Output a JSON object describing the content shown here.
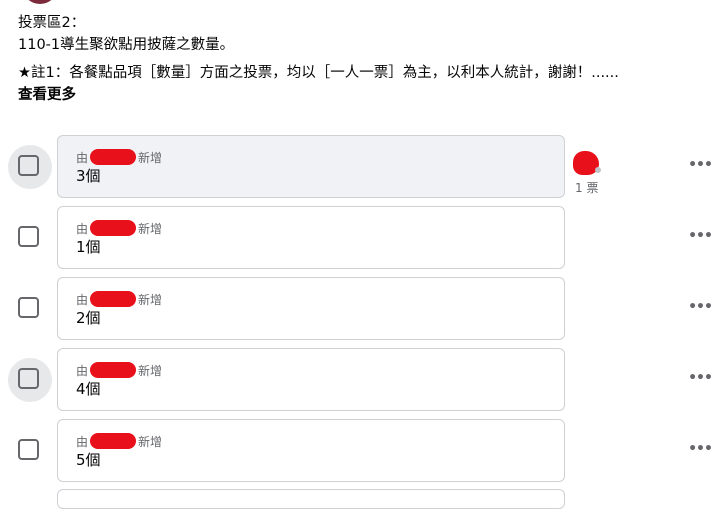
{
  "post": {
    "line1": "投票區2：",
    "line2": "110-1導生聚欲點用披薩之數量。",
    "line3": "★註1：各餐點品項［數量］方面之投票，均以［一人一票］為主，以利本人統計，謝謝！......",
    "see_more": "查看更多"
  },
  "poll": {
    "added_prefix": "由",
    "added_suffix": "新增",
    "options": [
      {
        "label": "3個",
        "votes": "1 票"
      },
      {
        "label": "1個"
      },
      {
        "label": "2個"
      },
      {
        "label": "4個"
      },
      {
        "label": "5個"
      }
    ],
    "more_label": "•••"
  },
  "colors": {
    "redaction": "#e8101a",
    "active_option_bg": "#f0f2f5",
    "border": "#ced0d4",
    "secondary_text": "#65676b"
  }
}
